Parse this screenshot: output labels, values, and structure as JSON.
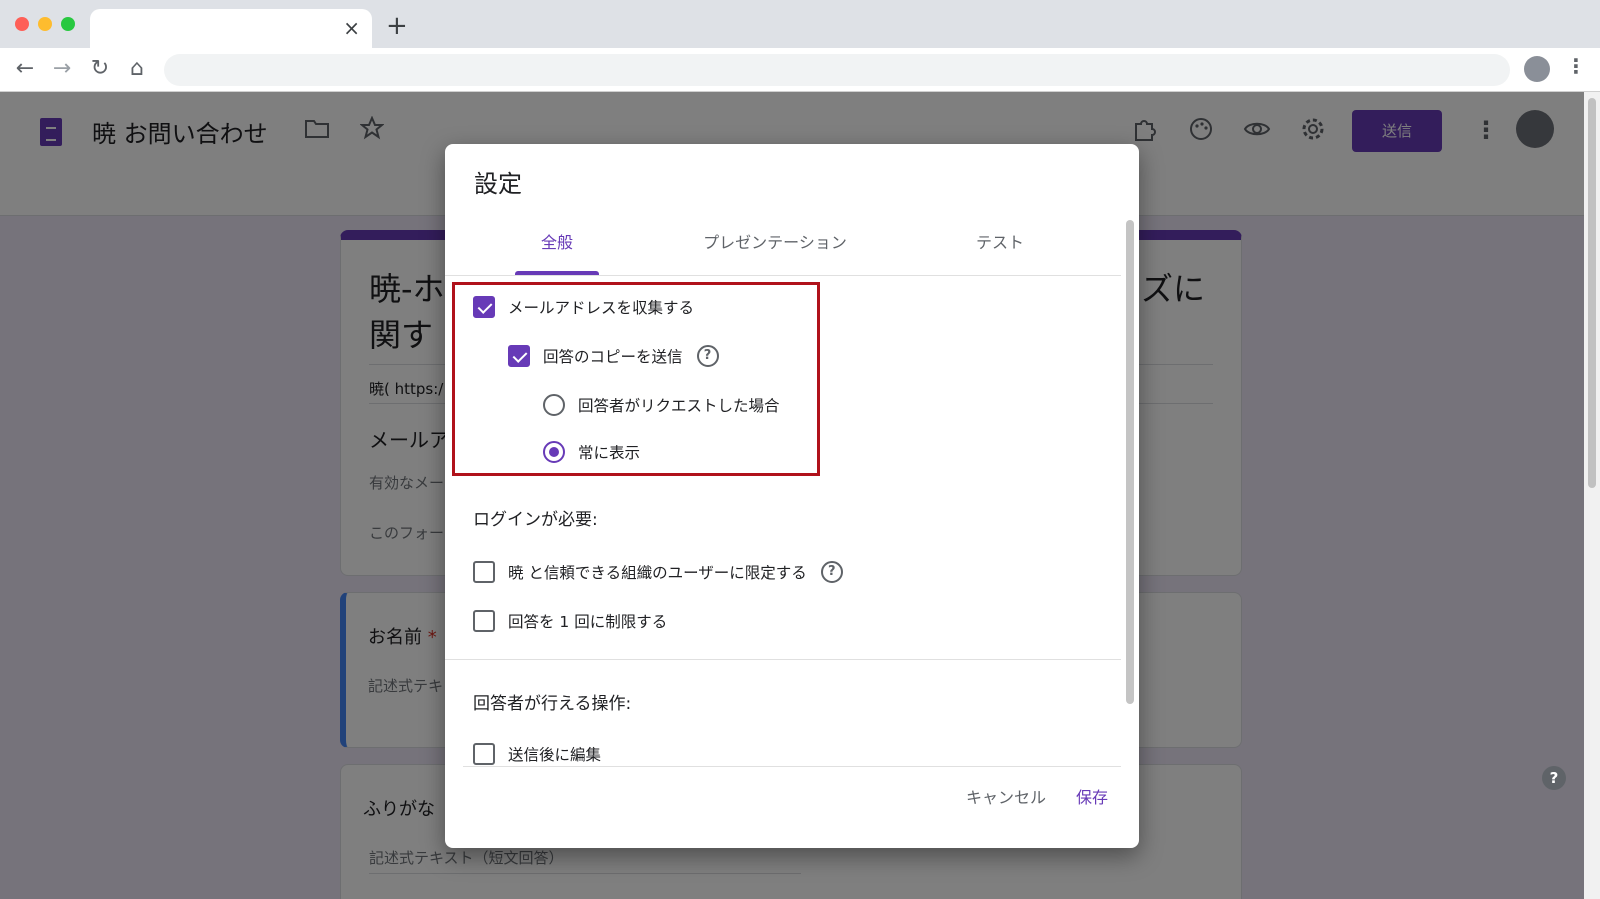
{
  "browser": {
    "tab_close": "×",
    "new_tab": "+",
    "back": "←",
    "forward": "→",
    "reload": "↻",
    "home": "⌂",
    "menu": "⋮"
  },
  "form_header": {
    "title": "暁 お問い合わせ",
    "send_label": "送信",
    "more": "⋮",
    "icons": [
      "folder-icon",
      "star-icon",
      "addon-icon",
      "palette-icon",
      "preview-icon",
      "settings-icon"
    ]
  },
  "form_cards": {
    "title_line1": "暁-ホ",
    "title_line2": "関す",
    "title_right": "ズに",
    "description": "暁( https:/",
    "email_label": "メールア",
    "email_hint": "有効なメー",
    "form_note": "このフォー",
    "q1_title": "お名前",
    "q1_required": "*",
    "q1_placeholder": "記述式テキ",
    "q2_title": "ふりがな",
    "q2_placeholder": "記述式テキスト（短文回答）"
  },
  "help_fab": "?",
  "dialog": {
    "title": "設定",
    "tabs": [
      {
        "label": "全般",
        "active": true
      },
      {
        "label": "プレゼンテーション",
        "active": false
      },
      {
        "label": "テスト",
        "active": false
      }
    ],
    "collect_email": {
      "label": "メールアドレスを収集する",
      "checked": true
    },
    "send_copy": {
      "label": "回答のコピーを送信",
      "checked": true,
      "help": "?"
    },
    "copy_options": [
      {
        "label": "回答者がリクエストした場合",
        "selected": false
      },
      {
        "label": "常に表示",
        "selected": true
      }
    ],
    "login_section": "ログインが必要:",
    "restrict_org": {
      "label": "暁 と信頼できる組織のユーザーに限定する",
      "checked": false,
      "help": "?"
    },
    "limit_one": {
      "label": "回答を 1 回に制限する",
      "checked": false
    },
    "respondent_section": "回答者が行える操作:",
    "edit_after": {
      "label": "送信後に編集",
      "checked": false
    },
    "cancel_label": "キャンセル",
    "save_label": "保存"
  },
  "colors": {
    "accent": "#673ab7",
    "highlight_box": "#b0121b",
    "overlay": "rgba(0,0,0,0.5)"
  }
}
